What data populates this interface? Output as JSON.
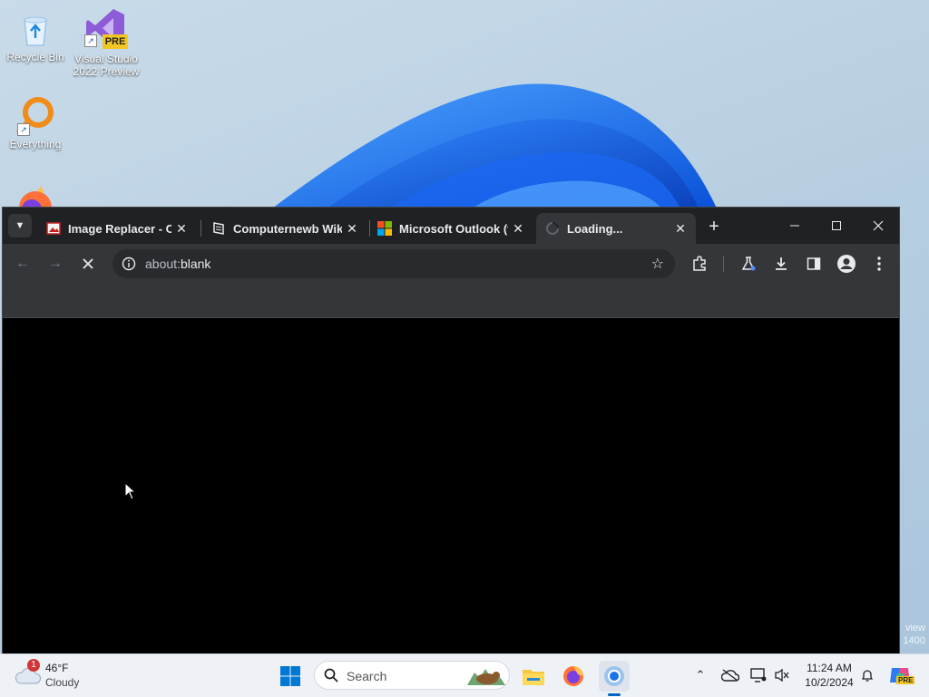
{
  "desktop": {
    "icons": [
      {
        "label": "Recycle Bin"
      },
      {
        "label": "Visual Studio 2022 Preview",
        "badge": "PRE"
      },
      {
        "label": "Everything"
      }
    ],
    "watermark": {
      "line1": "view",
      "line2": "1400"
    }
  },
  "browser": {
    "tabs": [
      {
        "title": "Image Replacer - Ch",
        "favicon": "image-replacer-favicon",
        "close": "✕"
      },
      {
        "title": "Computernewb Wiki",
        "favicon": "wiki-favicon",
        "close": "✕"
      },
      {
        "title": "Microsoft Outlook (f",
        "favicon": "microsoft-logo",
        "close": "✕"
      },
      {
        "title": "Loading...",
        "favicon": "loading-spinner",
        "close": "✕",
        "active": true
      }
    ],
    "new_tab": "+",
    "omnibox": {
      "scheme": "about:",
      "rest": "blank"
    },
    "colors": {
      "frame": "#202124",
      "toolbar": "#35363a",
      "omnibox": "#282a2d",
      "text": "#e8eaed"
    }
  },
  "taskbar": {
    "weather": {
      "temp": "46°F",
      "condition": "Cloudy",
      "alert_count": "1"
    },
    "search_label": "Search",
    "clock": {
      "time": "11:24 AM",
      "date": "10/2/2024"
    },
    "copilot_badge": "PRE"
  }
}
